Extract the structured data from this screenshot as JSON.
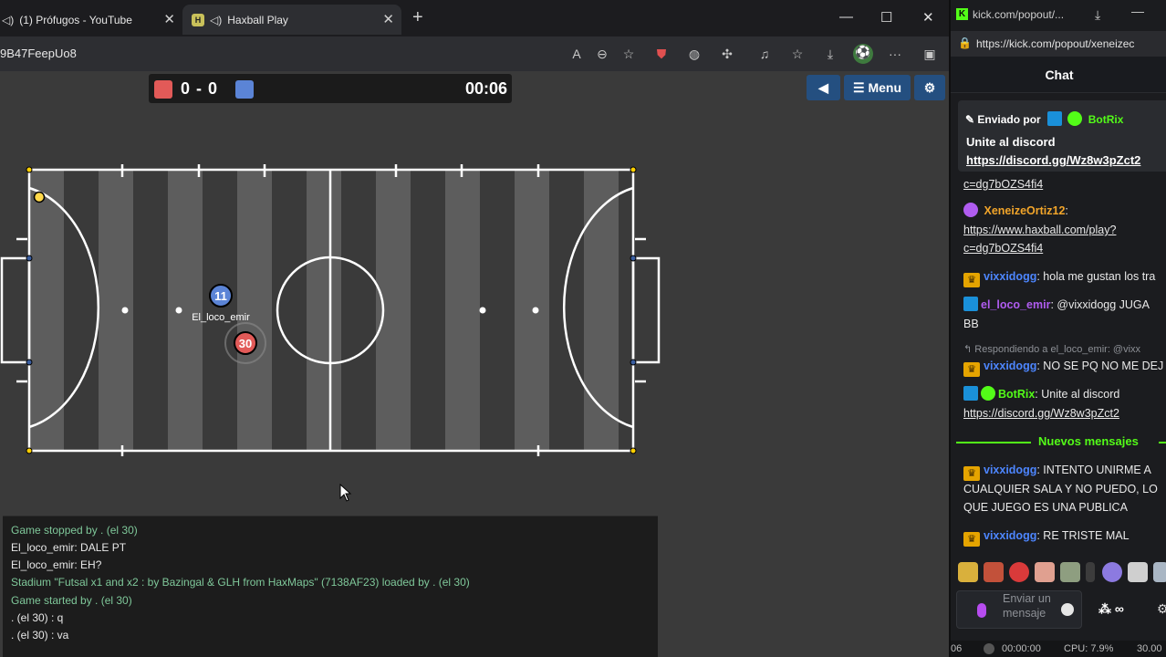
{
  "left_browser": {
    "tabs": [
      {
        "title": "(1) Prófugos - YouTube",
        "close": "✕"
      },
      {
        "title": "Haxball Play",
        "close": "✕"
      }
    ],
    "new_tab": "+",
    "window_controls": {
      "minimize": "—",
      "maximize": "☐",
      "close": "✕"
    },
    "url": "9B47FeepUo8",
    "favicon_hax": "H"
  },
  "scoreboard": {
    "red_color": "#e25a58",
    "blue_color": "#5b84d6",
    "score": "0 - 0",
    "timer": "00:06"
  },
  "game_controls": {
    "sound_icon": "speaker-icon",
    "menu_label": "☰ Menu",
    "settings_icon": "gear-icon"
  },
  "players": [
    {
      "number": "11",
      "name": "El_loco_emir",
      "team_color": "#5b84d6"
    },
    {
      "number": "30",
      "name": "",
      "team_color": "#e25a58"
    }
  ],
  "chat_log": [
    {
      "text": "Game stopped by . (el 30)",
      "type": "system"
    },
    {
      "text": "El_loco_emir: DALE PT",
      "type": "user"
    },
    {
      "text": "El_loco_emir: EH?",
      "type": "user"
    },
    {
      "text": "Stadium \"Futsal x1 and x2 : by Bazingal & GLH from HaxMaps\" (7138AF23) loaded by . (el 30)",
      "type": "system"
    },
    {
      "text": "Game started by . (el 30)",
      "type": "system"
    },
    {
      "text": ". (el 30) : q",
      "type": "user"
    },
    {
      "text": ". (el 30) : va",
      "type": "user"
    }
  ],
  "right_browser": {
    "tab_title": "kick.com/popout/...",
    "url": "https://kick.com/popout/xeneizec",
    "favicon": "K",
    "chat_title": "Chat",
    "pinned": {
      "sent_by_label": "Enviado por",
      "sender": "BotRix",
      "text": "Unite al discord",
      "link": "https://discord.gg/Wz8w3pZct2"
    },
    "messages": {
      "top_link_tail": "c=dg7bOZS4fi4",
      "m1_user": "XeneizeOrtiz12",
      "m1_link": "https://www.haxball.com/play?",
      "m1_link_tail": "c=dg7bOZS4fi4",
      "m2_user": "vixxidogg",
      "m2_text": ": hola me gustan los tra",
      "m3_user": "el_loco_emir",
      "m3_text": ": @vixxidogg JUGA",
      "m3_text_2": "BB",
      "reply_label": "↰ Respondiendo a el_loco_emir: @vixx",
      "m4_user": "vixxidogg",
      "m4_text": ": NO SE PQ NO ME DEJ",
      "m5_user": "BotRix",
      "m5_text": ": Unite al discord",
      "m5_link": "https://discord.gg/Wz8w3pZct2",
      "divider": "Nuevos mensajes",
      "m6_user": "vixxidogg",
      "m6_line1": ": INTENTO UNIRME A",
      "m6_line2": "CUALQUIER SALA Y NO PUEDO, LO",
      "m6_line3": "QUE JUEGO ES UNA PUBLICA",
      "m7_user": "vixxidogg",
      "m7_text": ": RE TRISTE MAL"
    },
    "colors": {
      "kick_green": "#53fc18",
      "vixxidogg": "#4d86ff",
      "xeneize": "#f2a52a",
      "el_loco_emir": "#b05cf0",
      "botrix": "#53fc18"
    },
    "input_placeholder": "Enviar un mensaje",
    "points": "∞",
    "status": {
      "left": "06",
      "rec_time": "00:00:00",
      "cpu": "CPU: 7.9%",
      "fps": "30.00"
    }
  }
}
